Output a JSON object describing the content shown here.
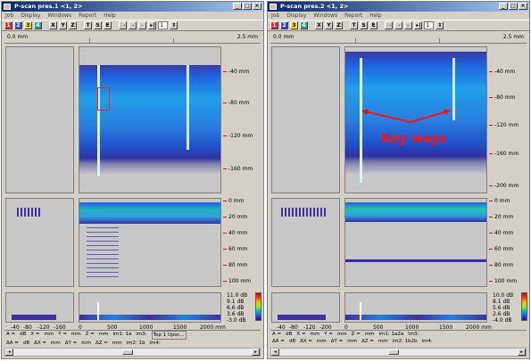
{
  "windows": [
    {
      "title": "P-scan pres.1 <1, 2>",
      "ruler_left": "0.0 mm",
      "ruler_right": "2.5 mm",
      "top_scale": [
        "-40 mm",
        "-80 mm",
        "-120 mm",
        "-160 mm"
      ],
      "mid_scale": [
        "0 mm",
        "20 mm",
        "40 mm",
        "60 mm",
        "80 mm",
        "100 mm"
      ],
      "db_scale": [
        "11.0 dB",
        "9.1 dB",
        "6.6 dB",
        "3.6 dB",
        "-3.0 dB"
      ],
      "bottom_left_axis": [
        "-40",
        "-80",
        "-120",
        "-160"
      ],
      "bottom_axis": [
        "0",
        "500",
        "1000",
        "1500",
        "2000 mm"
      ],
      "status": {
        "row1": [
          "A =",
          "dB",
          "X =",
          "mm",
          "Y =",
          "mm",
          "Z =",
          "mm",
          "im1: 1a",
          "im3:"
        ],
        "row2": [
          "ΔA =",
          "dB",
          "ΔX =",
          "mm",
          "ΔY =",
          "mm",
          "ΔZ =",
          "mm",
          "im2: 1b",
          "im4:"
        ],
        "extra": "Top 1 Upsc..."
      },
      "toolbar_value": "1"
    },
    {
      "title": "P-scan pres.2 <1, 2>",
      "ruler_left": "0.0 mm",
      "ruler_right": "2.5 mm",
      "top_scale": [
        "-40 mm",
        "-80 mm",
        "-120 mm",
        "-160 mm",
        "-200 mm"
      ],
      "mid_scale": [
        "0 mm",
        "20 mm",
        "40 mm",
        "60 mm",
        "80 mm",
        "100 mm"
      ],
      "db_scale": [
        "10.0 dB",
        "8.1 dB",
        "5.6 dB",
        "2.6 dB",
        "-4.0 dB"
      ],
      "bottom_left_axis": [
        "-40",
        "-80",
        "-120",
        "-200"
      ],
      "bottom_axis": [
        "0",
        "500",
        "1000",
        "1500",
        "2000 mm"
      ],
      "status": {
        "row1": [
          "A =",
          "dB",
          "X =",
          "mm",
          "Y =",
          "mm",
          "Z =",
          "mm",
          "im1: 1a2a",
          "im3:"
        ],
        "row2": [
          "ΔA =",
          "dB",
          "ΔX =",
          "mm",
          "ΔY =",
          "mm",
          "ΔZ =",
          "mm",
          "im2: 1b2b",
          "im4:"
        ],
        "extra": ""
      },
      "toolbar_value": "1",
      "annotation": "Key ways"
    }
  ],
  "menu": [
    "Job",
    "Display",
    "Windows",
    "Report",
    "Help"
  ],
  "toolbar_buttons": [
    "1",
    "2",
    "3",
    "4",
    "X",
    "Y",
    "Z",
    "T",
    "S",
    "E"
  ],
  "colors": {
    "title_start": "#0a246a",
    "scan_blue": "#2060e0",
    "annotation_red": "#ff1010"
  }
}
